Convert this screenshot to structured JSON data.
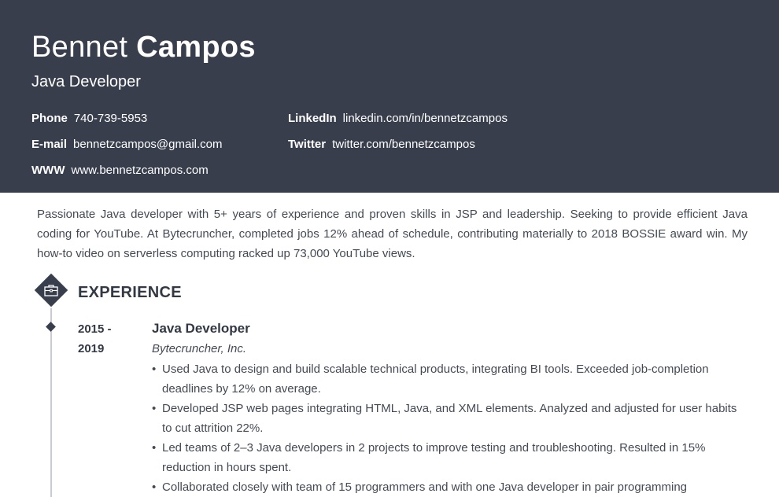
{
  "header": {
    "first_name": "Bennet",
    "last_name": "Campos",
    "title": "Java Developer",
    "contacts": [
      {
        "label": "Phone",
        "value": "740-739-5953"
      },
      {
        "label": "E-mail",
        "value": "bennetzcampos@gmail.com"
      },
      {
        "label": "WWW",
        "value": "www.bennetzcampos.com"
      },
      {
        "label": "LinkedIn",
        "value": "linkedin.com/in/bennetzcampos"
      },
      {
        "label": "Twitter",
        "value": "twitter.com/bennetzcampos"
      }
    ]
  },
  "summary": "Passionate Java developer with 5+ years of experience and proven skills in JSP and leadership. Seeking to provide efficient Java coding for YouTube. At Bytecruncher, completed jobs 12% ahead of schedule, contributing materially to 2018 BOSSIE award win. My how-to video on serverless computing racked up 73,000 YouTube views.",
  "experience": {
    "section_title": "EXPERIENCE",
    "section_icon": "briefcase-icon",
    "jobs": [
      {
        "dates": "2015 - 2019",
        "role": "Java Developer",
        "company": "Bytecruncher, Inc.",
        "bullets": [
          "Used Java to design and build scalable technical products, integrating BI tools. Exceeded job-completion deadlines by 12% on average.",
          "Developed JSP web pages integrating HTML, Java, and XML elements. Analyzed and adjusted for user habits to cut attrition 22%.",
          "Led teams of 2–3 Java developers in 2 projects to improve testing and troubleshooting. Resulted in 15% reduction in hours spent.",
          "Collaborated closely with team of 15 programmers and with one Java developer in pair programming"
        ]
      }
    ]
  },
  "colors": {
    "header_bg": "#383e4c",
    "text": "#333944",
    "timeline": "#c9cbd0"
  }
}
